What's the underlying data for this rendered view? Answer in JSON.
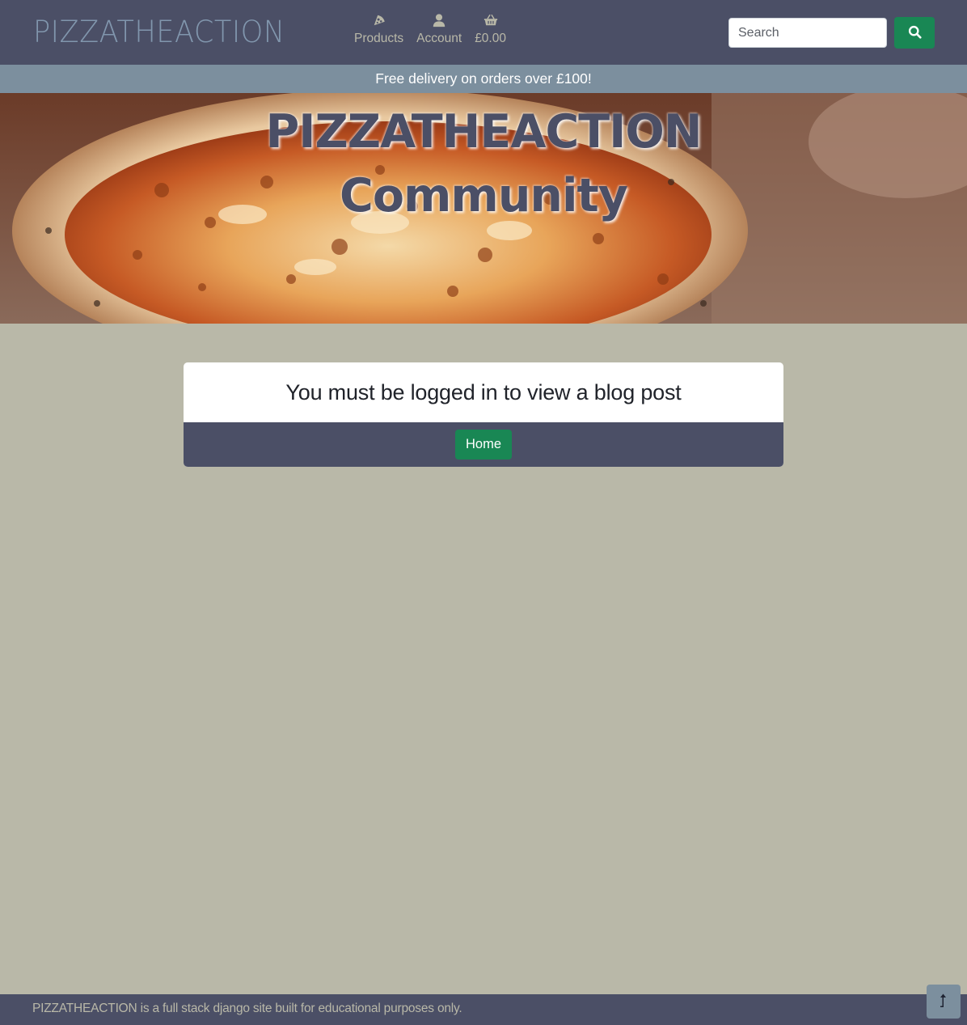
{
  "header": {
    "brand": "PIZZATHEACTION",
    "nav": [
      {
        "label": "Products",
        "icon": "pizza-slice-icon"
      },
      {
        "label": "Account",
        "icon": "user-icon"
      },
      {
        "label": "£0.00",
        "icon": "shopping-basket-icon"
      }
    ],
    "search": {
      "placeholder": "Search",
      "value": "",
      "button_icon": "search-icon"
    }
  },
  "promo": {
    "text": "Free delivery on orders over £100!"
  },
  "hero": {
    "title_line1": "PIZZATHEACTION",
    "title_line2": "Community"
  },
  "card": {
    "title": "You must be logged in to view a blog post",
    "button_label": "Home"
  },
  "footer": {
    "text": "PIZZATHEACTION is a full stack django site built for educational purposes only.",
    "back_to_top_icon": "level-up-arrow-icon"
  },
  "colors": {
    "navbar": "#4b4f66",
    "page_background": "#b9b8a8",
    "promo_banner": "#7c8f9e",
    "accent_green": "#198754",
    "brand_text": "#8196ad"
  }
}
